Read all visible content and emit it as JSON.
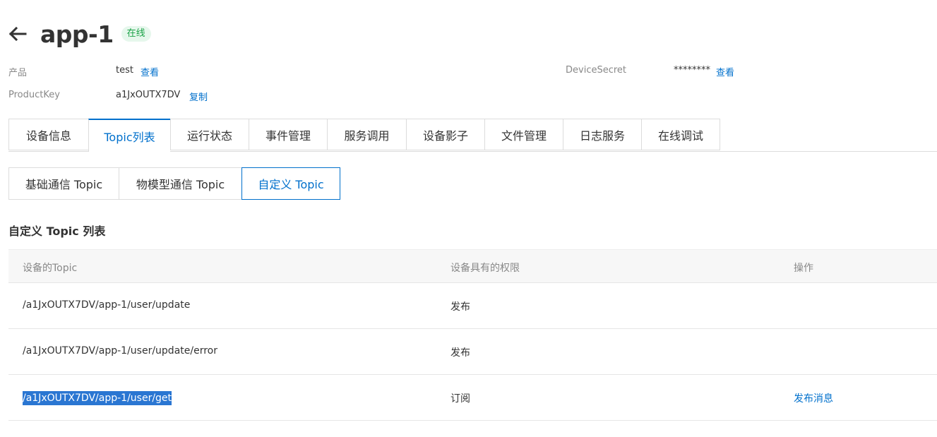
{
  "header": {
    "title": "app-1",
    "status": "在线"
  },
  "info": {
    "product_label": "产品",
    "product_value": "test",
    "product_link": "查看",
    "productkey_label": "ProductKey",
    "productkey_value": "a1JxOUTX7DV",
    "productkey_link": "复制",
    "secret_label": "DeviceSecret",
    "secret_value": "********",
    "secret_link": "查看"
  },
  "tabs": [
    "设备信息",
    "Topic列表",
    "运行状态",
    "事件管理",
    "服务调用",
    "设备影子",
    "文件管理",
    "日志服务",
    "在线调试"
  ],
  "active_tab": "Topic列表",
  "subtabs": [
    "基础通信 Topic",
    "物模型通信 Topic",
    "自定义 Topic"
  ],
  "active_subtab": "自定义 Topic",
  "section_title": "自定义 Topic 列表",
  "table": {
    "headers": [
      "设备的Topic",
      "设备具有的权限",
      "操作"
    ],
    "rows": [
      {
        "topic": "/a1JxOUTX7DV/app-1/user/update",
        "permission": "发布",
        "action": ""
      },
      {
        "topic": "/a1JxOUTX7DV/app-1/user/update/error",
        "permission": "发布",
        "action": ""
      },
      {
        "topic": "/a1JxOUTX7DV/app-1/user/get",
        "permission": "订阅",
        "action": "发布消息"
      }
    ]
  },
  "colors": {
    "accent": "#0070cc",
    "online": "#1aa246",
    "selection": "#2a76d2"
  },
  "icons": {
    "back": "arrow-left-icon"
  }
}
